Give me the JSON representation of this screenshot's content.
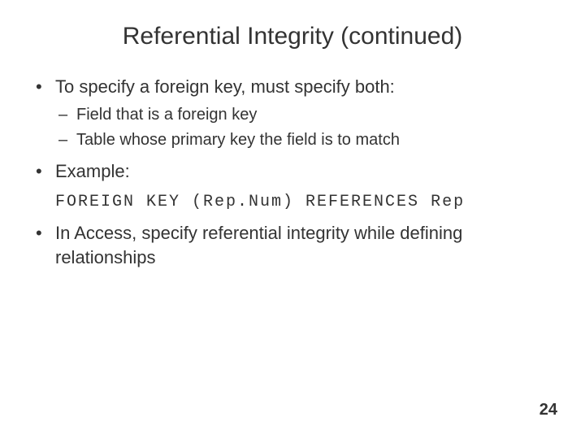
{
  "slide": {
    "title": "Referential Integrity (continued)",
    "bullets": {
      "b1": "To specify a foreign key, must specify both:",
      "b1_sub": {
        "s1": "Field that is a foreign key",
        "s2": "Table whose primary key the field is to match"
      },
      "b2": "Example:",
      "b2_code": "FOREIGN KEY (Rep.Num) REFERENCES Rep",
      "b3": "In Access, specify referential integrity while defining relationships"
    },
    "page_number": "24"
  }
}
